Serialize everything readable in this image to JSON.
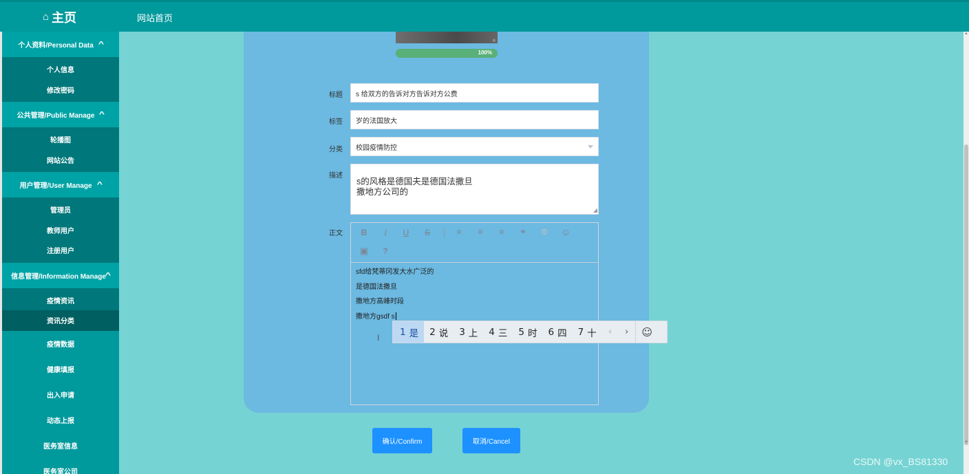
{
  "header": {
    "home_icon": "home-icon",
    "brand_title": "主页",
    "nav_link": "网站首页"
  },
  "sidebar": {
    "groups": [
      {
        "title": "个人资料/Personal Data",
        "items": [
          "个人信息",
          "修改密码"
        ]
      },
      {
        "title": "公共管理/Public Manage",
        "items": [
          "轮播图",
          "网站公告"
        ]
      },
      {
        "title": "用户管理/User Manage",
        "items": [
          "管理员",
          "教师用户",
          "注册用户"
        ]
      },
      {
        "title": "信息管理/Information Manage",
        "items": [
          "疫情资讯",
          "资讯分类"
        ]
      }
    ],
    "plain_items": [
      "疫情数据",
      "健康填报",
      "出入申请",
      "动态上报",
      "医务室信息",
      "医务室公司"
    ]
  },
  "form": {
    "upload_progress": "100%",
    "upload_progress_value": 100,
    "title_label": "标题",
    "title_value": "s 给双方的告诉对方告诉对方公费",
    "tag_label": "标签",
    "tag_value": "岁的法国放大",
    "category_label": "分类",
    "category_value": "校园疫情防控",
    "desc_label": "描述",
    "desc_value": "s的风格是德国夫是德国法撒旦\n撒地方公司的",
    "body_label": "正文",
    "body_lines": [
      "sfd给梵蒂冈发大水广泛的",
      "是德国法撒旦",
      "撒地方高峰时段",
      "撒地方gsdf s"
    ]
  },
  "toolbar": {
    "bold": "B",
    "italic": "I",
    "underline": "U",
    "strike": "S",
    "help": "?"
  },
  "ime": {
    "candidates": [
      {
        "num": "1",
        "text": "是"
      },
      {
        "num": "2",
        "text": "说"
      },
      {
        "num": "3",
        "text": "上"
      },
      {
        "num": "4",
        "text": "三"
      },
      {
        "num": "5",
        "text": "时"
      },
      {
        "num": "6",
        "text": "四"
      },
      {
        "num": "7",
        "text": "十"
      }
    ],
    "prev": "‹",
    "next": "›",
    "emoji": "☺"
  },
  "actions": {
    "confirm": "确认/Confirm",
    "cancel": "取消/Cancel"
  },
  "watermark": "CSDN @vx_BS81330"
}
